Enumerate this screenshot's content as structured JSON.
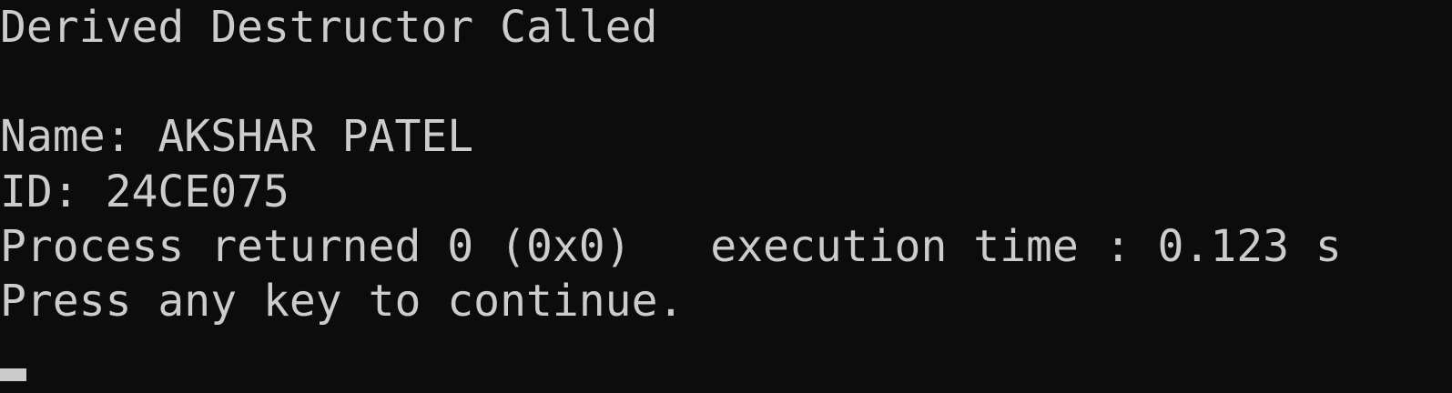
{
  "console": {
    "lines": [
      "Derived Destructor Called",
      "Name: AKSHAR PATEL",
      "ID: 24CE075",
      "Process returned 0 (0x0)   execution time : 0.123 s",
      "Press any key to continue."
    ],
    "colors": {
      "background": "#0c0c0c",
      "foreground": "#cccccc"
    }
  }
}
